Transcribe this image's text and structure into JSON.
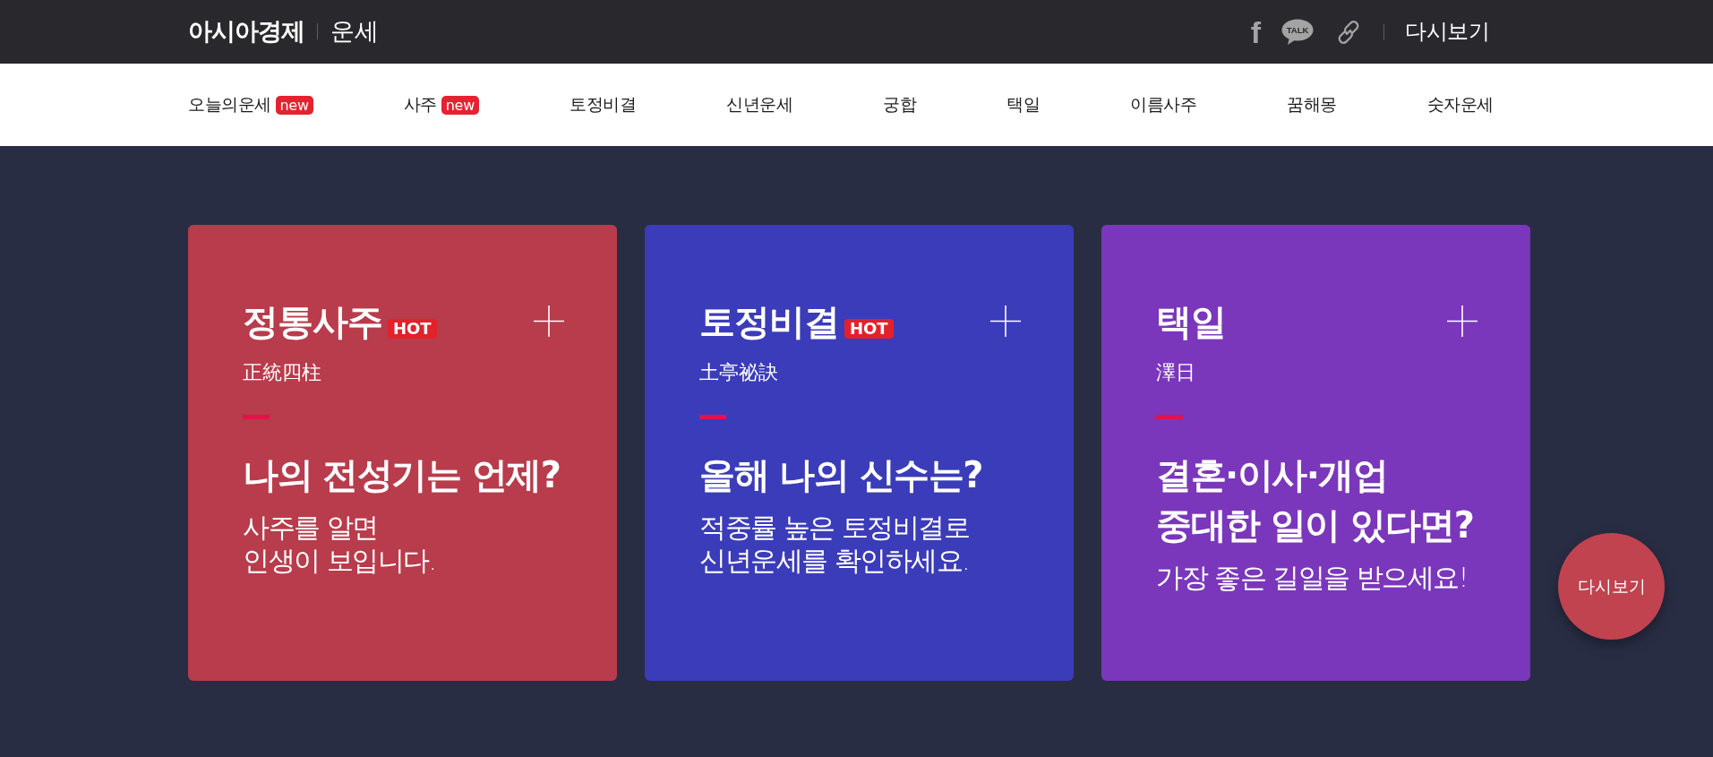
{
  "header": {
    "logo": "아시아경제",
    "section": "운세",
    "share_icons": [
      {
        "kind": "facebook",
        "glyph": "f"
      },
      {
        "kind": "talk",
        "glyph": "TALK"
      },
      {
        "kind": "link"
      }
    ],
    "replay_link": "다시보기"
  },
  "nav": {
    "items": [
      {
        "label": "오늘의운세",
        "badge": "new"
      },
      {
        "label": "사주",
        "badge": "new"
      },
      {
        "label": "토정비결"
      },
      {
        "label": "신년운세"
      },
      {
        "label": "궁합"
      },
      {
        "label": "택일"
      },
      {
        "label": "이름사주"
      },
      {
        "label": "꿈해몽"
      },
      {
        "label": "숫자운세"
      }
    ]
  },
  "cards": [
    {
      "title": "정통사주",
      "badge": "HOT",
      "hanja": "正統四柱",
      "headline": "나의 전성기는 언제?",
      "description": "사주를 알면\n인생이 보입니다.",
      "color": "#b83c4b"
    },
    {
      "title": "토정비결",
      "badge": "HOT",
      "hanja": "土亭祕訣",
      "headline": "올해 나의 신수는?",
      "description": "적중률 높은 토정비결로\n신년운세를 확인하세요.",
      "color": "#3b3cb9"
    },
    {
      "title": "택일",
      "hanja": "澤日",
      "headline": "결혼·이사·개업\n중대한 일이 있다면?",
      "description": "가장 좋은 길일을 받으세요!",
      "color": "#7a37bb"
    }
  ],
  "floating_button": {
    "label": "다시보기"
  }
}
